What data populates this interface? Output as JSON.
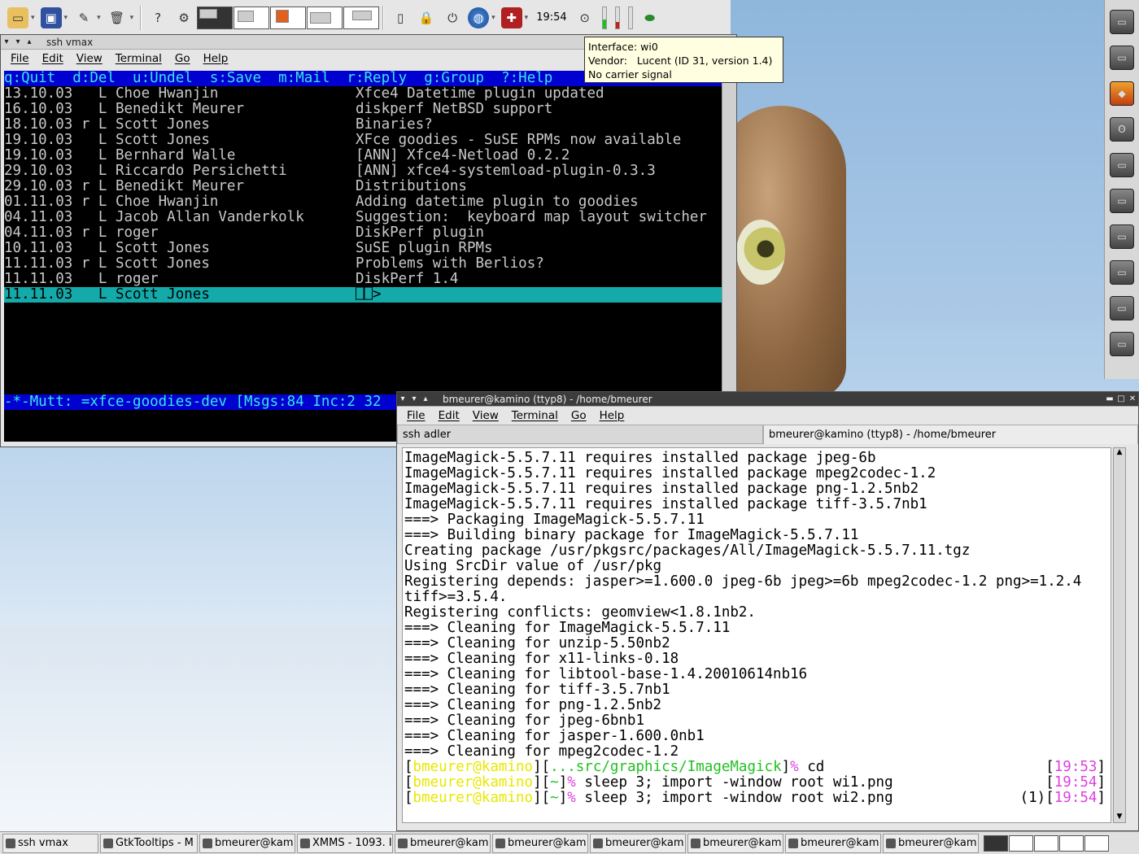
{
  "top_panel": {
    "clock": "19:54",
    "icons": [
      "folder-icon",
      "terminal-icon",
      "editor-icon",
      "trash-icon",
      "help-icon",
      "settings-icon",
      "network-icon",
      "globe-icon",
      "toolbox-icon"
    ]
  },
  "tooltip": {
    "lines": [
      "Interface: wi0",
      "Vendor:   Lucent (ID 31, version 1.4)",
      "No carrier signal"
    ]
  },
  "mutt_window": {
    "title": "ssh vmax",
    "menu": [
      "File",
      "Edit",
      "View",
      "Terminal",
      "Go",
      "Help"
    ],
    "help_line": "q:Quit  d:Del  u:Undel  s:Save  m:Mail  r:Reply  g:Group  ?:Help",
    "messages": [
      "13.10.03   L Choe Hwanjin                Xfce4 Datetime plugin updated",
      "16.10.03   L Benedikt Meurer             diskperf NetBSD support",
      "18.10.03 r L Scott Jones                 Binaries?",
      "19.10.03   L Scott Jones                 XFce goodies - SuSE RPMs now available",
      "19.10.03   L Bernhard Walle              [ANN] Xfce4-Netload 0.2.2",
      "29.10.03   L Riccardo Persichetti        [ANN] xfce4-systemload-plugin-0.3.3",
      "29.10.03 r L Benedikt Meurer             Distributions",
      "01.11.03 r L Choe Hwanjin                Adding datetime plugin to goodies",
      "04.11.03   L Jacob Allan Vanderkolk      Suggestion:  keyboard map layout switcher",
      "04.11.03 r L roger                       DiskPerf plugin",
      "10.11.03   L Scott Jones                 SuSE plugin RPMs",
      "11.11.03 r L Scott Jones                 Problems with Berlios?",
      "11.11.03   L roger                       DiskPerf 1.4",
      "11.11.03   L Scott Jones                 ⎕⎕>"
    ],
    "status_line": "-*-Mutt: =xfce-goodies-dev [Msgs:84 Inc:2 32"
  },
  "term_window": {
    "title": "bmeurer@kamino (ttyp8) - /home/bmeurer",
    "menu": [
      "File",
      "Edit",
      "View",
      "Terminal",
      "Go",
      "Help"
    ],
    "tabs": [
      "ssh adler",
      "bmeurer@kamino (ttyp8) - /home/bmeurer"
    ],
    "lines": [
      "ImageMagick-5.5.7.11 requires installed package jpeg-6b",
      "ImageMagick-5.5.7.11 requires installed package mpeg2codec-1.2",
      "ImageMagick-5.5.7.11 requires installed package png-1.2.5nb2",
      "ImageMagick-5.5.7.11 requires installed package tiff-3.5.7nb1",
      "===> Packaging ImageMagick-5.5.7.11",
      "===> Building binary package for ImageMagick-5.5.7.11",
      "Creating package /usr/pkgsrc/packages/All/ImageMagick-5.5.7.11.tgz",
      "Using SrcDir value of /usr/pkg",
      "Registering depends: jasper>=1.600.0 jpeg-6b jpeg>=6b mpeg2codec-1.2 png>=1.2.4",
      "tiff>=3.5.4.",
      "Registering conflicts: geomview<1.8.1nb2.",
      "===> Cleaning for ImageMagick-5.5.7.11",
      "===> Cleaning for unzip-5.50nb2",
      "===> Cleaning for x11-links-0.18",
      "===> Cleaning for libtool-base-1.4.20010614nb16",
      "===> Cleaning for tiff-3.5.7nb1",
      "===> Cleaning for png-1.2.5nb2",
      "===> Cleaning for jpeg-6bnb1",
      "===> Cleaning for jasper-1.600.0nb1",
      "===> Cleaning for mpeg2codec-1.2"
    ],
    "prompts": [
      {
        "user": "bmeurer@kamino",
        "dir": "...src/graphics/ImageMagick",
        "cmd": " cd",
        "right_prefix": "",
        "time": "19:53"
      },
      {
        "user": "bmeurer@kamino",
        "dir": "~",
        "cmd": " sleep 3; import -window root wi1.png",
        "right_prefix": "",
        "time": "19:54"
      },
      {
        "user": "bmeurer@kamino",
        "dir": "~",
        "cmd": " sleep 3; import -window root wi2.png",
        "right_prefix": "(1)",
        "time": "19:54"
      }
    ]
  },
  "taskbar": {
    "tasks": [
      "ssh vmax",
      "GtkTooltips - M",
      "bmeurer@kam",
      "XMMS - 1093. I",
      "bmeurer@kam",
      "bmeurer@kam",
      "bmeurer@kam",
      "bmeurer@kam",
      "bmeurer@kam",
      "bmeurer@kam"
    ]
  },
  "colors": {
    "mutt_status_bg": "#0000d0",
    "mutt_status_fg": "#38e6e6",
    "mutt_select": "#14aaaa",
    "prompt_user": "#e8e800",
    "prompt_dir": "#22c022",
    "prompt_sym": "#e040e0"
  }
}
